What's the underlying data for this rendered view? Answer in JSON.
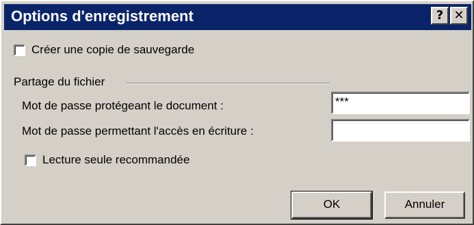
{
  "window": {
    "title": "Options d'enregistrement",
    "help_glyph": "?",
    "close_glyph": "✕"
  },
  "backup": {
    "label": "Créer une copie de sauvegarde",
    "checked": false
  },
  "sharing": {
    "group_label": "Partage du fichier",
    "open_password_label": "Mot de passe protégeant le document :",
    "open_password_value": "***",
    "write_password_label": "Mot de passe permettant l'accès en écriture :",
    "write_password_value": "",
    "readonly_label": "Lecture seule recommandée",
    "readonly_checked": false
  },
  "buttons": {
    "ok": "OK",
    "cancel": "Annuler"
  }
}
